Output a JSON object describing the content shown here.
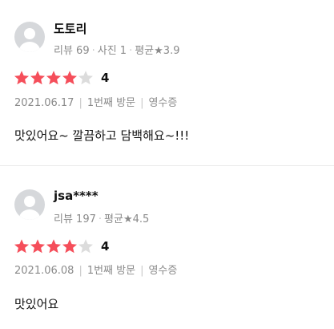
{
  "reviews": [
    {
      "nickname": "도토리",
      "stats": {
        "review": "리뷰 69",
        "photo": "사진 1",
        "avg_label": "평균",
        "avg_star": "★",
        "avg_value": "3.9"
      },
      "rating": 4,
      "score": "4",
      "date": "2021.06.17",
      "visit": "1번째 방문",
      "receipt": "영수증",
      "content": "맛있어요~ 깔끔하고 담백해요~!!!"
    },
    {
      "nickname": "jsa****",
      "stats": {
        "review": "리뷰 197",
        "avg_label": "평균",
        "avg_star": "★",
        "avg_value": "4.5"
      },
      "rating": 4,
      "score": "4",
      "date": "2021.06.08",
      "visit": "1번째 방문",
      "receipt": "영수증",
      "content": "맛있어요"
    }
  ],
  "colors": {
    "star_filled": "#f54e5a",
    "star_empty": "#dcdcdc",
    "meta_text": "#8a8a8a"
  },
  "icons": {
    "avatar": "default-profile-icon",
    "star": "star-icon"
  }
}
